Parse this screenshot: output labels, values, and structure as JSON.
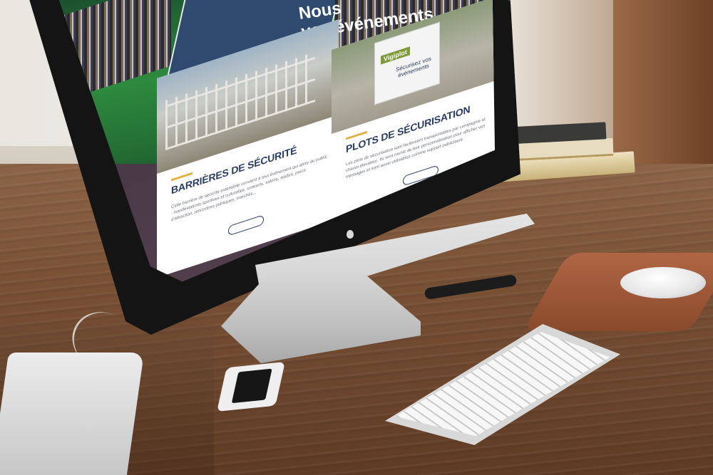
{
  "hero": {
    "title_line1": "Nous",
    "title_line2": "vos événements"
  },
  "cards": [
    {
      "title": "BARRIÈRES DE SÉCURITÉ",
      "body": "Cette barrière de sécurité extensible convient à tout événement qui attire du public : manifestations sportives et culturelles, concerts, salons, stades, parcs d'attraction, rencontres publiques, marchés..."
    },
    {
      "title": "PLOTS DE SÉCURISATION",
      "body": "Les plots de sécurisation sont facilement transportables par compagnie et chariot élévateur. Ils sont munis de leur personnalisation pour afficher vos messages et sont aussi utilisables comme support publicitaire.",
      "image_logo": "Vigiplot",
      "image_text": "Sécurisez vos événements"
    }
  ],
  "colors": {
    "brand_navy": "#2a3b63",
    "accent_yellow": "#e3b13a",
    "site_background": "#4d3c4a"
  }
}
